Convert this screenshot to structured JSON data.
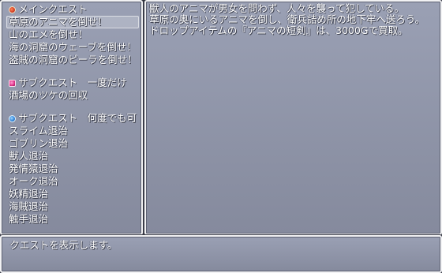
{
  "quest_list": {
    "main_header": "メインクエスト",
    "main_items": [
      "草原のアニマを倒せ！",
      "山のエメを倒せ！",
      "海の洞窟のウェーブを倒せ！",
      "盗賊の洞窟のピーラを倒せ！"
    ],
    "once_header": "サブクエスト　一度だけ",
    "once_items": [
      "酒場のツケの回収"
    ],
    "repeat_header": "サブクエスト　何度でも可",
    "repeat_items": [
      "スライム退治",
      "ゴブリン退治",
      "獣人退治",
      "発情猿退治",
      "オーク退治",
      "妖精退治",
      "海賊退治",
      "触手退治"
    ],
    "icons": {
      "main": "main-quest-icon",
      "once": "once-quest-icon",
      "repeat": "repeat-quest-icon"
    }
  },
  "detail": {
    "lines": [
      "獣人のアニマが男女を問わず、人々を襲って犯している。",
      "草原の奥にいるアニマを倒し、衛兵詰め所の地下牢へ送ろう。",
      "ドロップアイテムの『アニマの短剣』は、3000Gで買取。"
    ]
  },
  "help": {
    "text": "クエストを表示します。"
  }
}
